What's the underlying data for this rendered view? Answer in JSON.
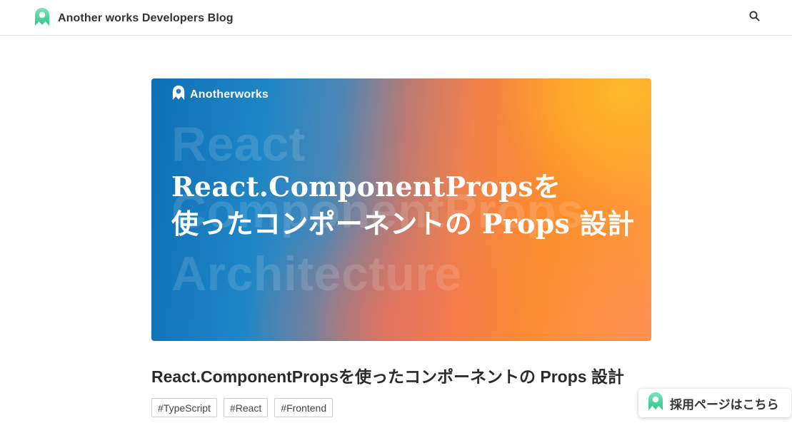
{
  "header": {
    "site_title": "Another works Developers Blog",
    "logo_icon": "anotherworks-logo-icon",
    "search_icon": "search-icon"
  },
  "hero": {
    "brand_text": "Anotherworks",
    "background_words": [
      "React",
      "ComponentProps",
      "Architecture"
    ],
    "title_lines": [
      "React.ComponentPropsを",
      "使ったコンポーネントの Props 設計"
    ]
  },
  "article": {
    "title": "React.ComponentPropsを使ったコンポーネントの Props 設計",
    "tags": [
      "#TypeScript",
      "#React",
      "#Frontend"
    ]
  },
  "recruit_button": {
    "label": "採用ページはこちら"
  },
  "colors": {
    "accent_green": "#3dd6a0",
    "hero_blue": "#0e6fb4",
    "hero_orange": "#fb8d2d"
  }
}
